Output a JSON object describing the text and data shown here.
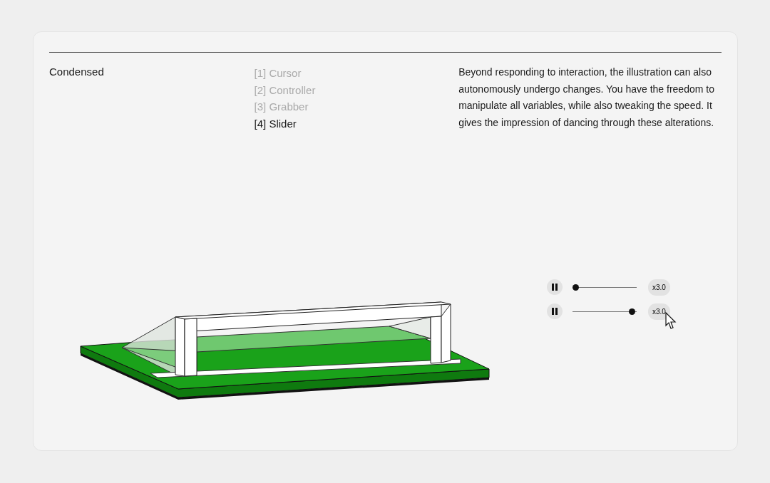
{
  "section": {
    "title": "Condensed"
  },
  "modes": [
    {
      "label": "[1] Cursor",
      "selected": false
    },
    {
      "label": "[2] Controller",
      "selected": false
    },
    {
      "label": "[3] Grabber",
      "selected": false
    },
    {
      "label": "[4] Slider",
      "selected": true
    }
  ],
  "description": "Beyond responding to interaction, the illustration can also autonomously undergo changes. You have the freedom to manipulate all variables, while also tweaking the speed. It gives the impression of dancing through these alterations.",
  "sliders": [
    {
      "level": 0.0,
      "reading": "x3.0"
    },
    {
      "level": 0.97,
      "reading": "x3.0"
    }
  ]
}
